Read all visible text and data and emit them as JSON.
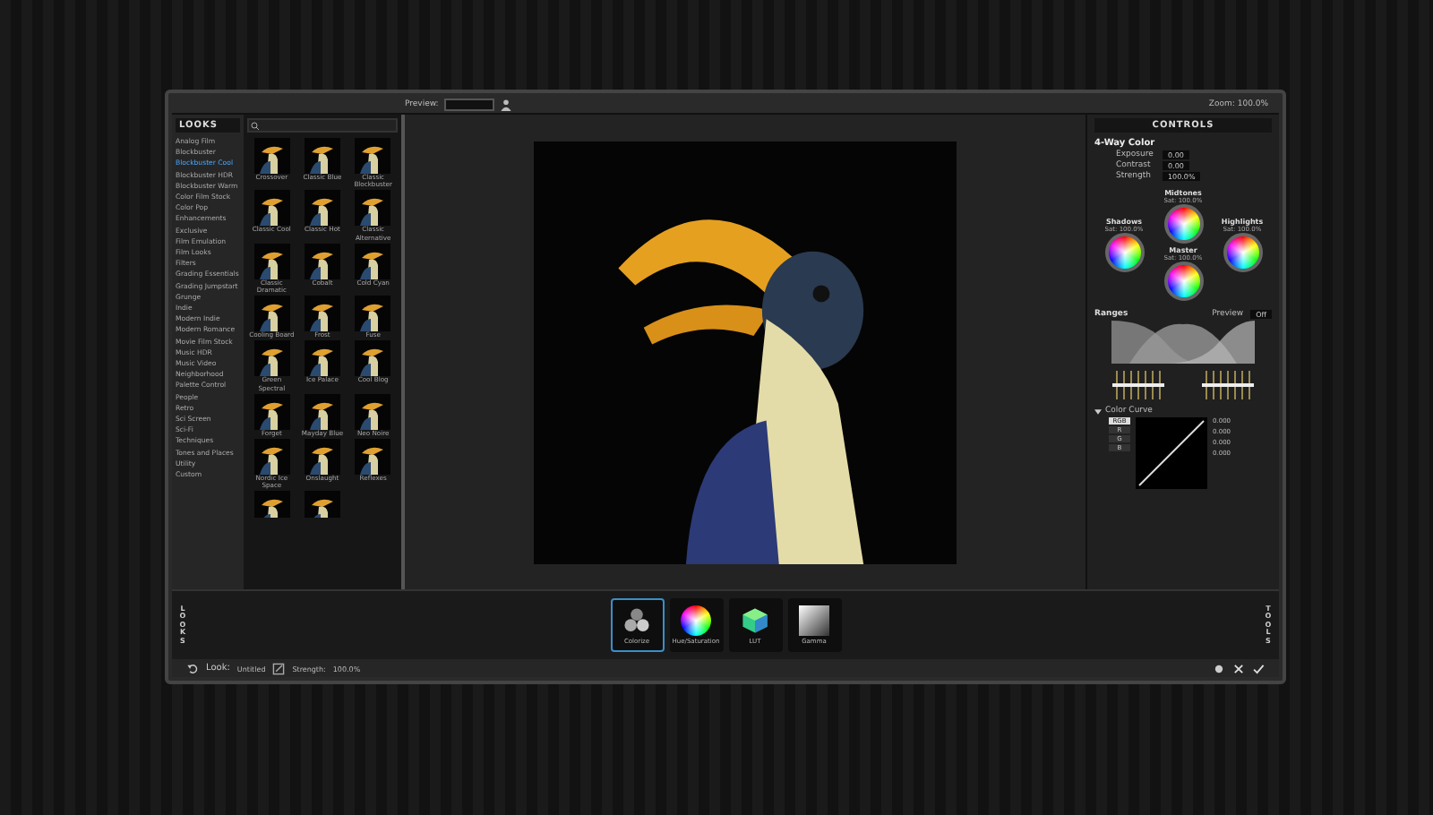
{
  "top_bar": {
    "preview_label": "Preview:",
    "zoom": "Zoom: 100.0%"
  },
  "looks_panel": {
    "title": "LOOKS"
  },
  "categories": [
    {
      "label": "Analog Film",
      "selected": false
    },
    {
      "label": "Blockbuster",
      "selected": false
    },
    {
      "label": "Blockbuster Cool",
      "selected": true
    },
    {
      "label": "Blockbuster HDR",
      "selected": false
    },
    {
      "label": "Blockbuster Warm",
      "selected": false
    },
    {
      "label": "Color Film Stock",
      "selected": false
    },
    {
      "label": "Color Pop",
      "selected": false
    },
    {
      "label": "Enhancements",
      "selected": false
    },
    {
      "label": "Exclusive",
      "selected": false
    },
    {
      "label": "Film Emulation",
      "selected": false
    },
    {
      "label": "Film Looks",
      "selected": false
    },
    {
      "label": "Filters",
      "selected": false
    },
    {
      "label": "Grading Essentials",
      "selected": false
    },
    {
      "label": "Grading Jumpstart",
      "selected": false
    },
    {
      "label": "Grunge",
      "selected": false
    },
    {
      "label": "Indie",
      "selected": false
    },
    {
      "label": "Modern Indie",
      "selected": false
    },
    {
      "label": "Modern Romance",
      "selected": false
    },
    {
      "label": "Movie Film Stock",
      "selected": false
    },
    {
      "label": "Music HDR",
      "selected": false
    },
    {
      "label": "Music Video",
      "selected": false
    },
    {
      "label": "Neighborhood",
      "selected": false
    },
    {
      "label": "Palette Control",
      "selected": false
    },
    {
      "label": "People",
      "selected": false
    },
    {
      "label": "Retro",
      "selected": false
    },
    {
      "label": "Sci Screen",
      "selected": false
    },
    {
      "label": "Sci-Fi",
      "selected": false
    },
    {
      "label": "Techniques",
      "selected": false
    },
    {
      "label": "Tones and Places",
      "selected": false
    },
    {
      "label": "Utility",
      "selected": false
    },
    {
      "label": "Custom",
      "selected": false
    }
  ],
  "thumbnails": [
    {
      "label": "Crossover"
    },
    {
      "label": "Classic Blue"
    },
    {
      "label": "Classic Blockbuster"
    },
    {
      "label": "Classic Cool"
    },
    {
      "label": "Classic Hot"
    },
    {
      "label": "Classic Alternative"
    },
    {
      "label": "Classic Dramatic"
    },
    {
      "label": "Cobalt"
    },
    {
      "label": "Cold Cyan"
    },
    {
      "label": "Cooling Board"
    },
    {
      "label": "Frost"
    },
    {
      "label": "Fuse"
    },
    {
      "label": "Green Spectral"
    },
    {
      "label": "Ice Palace"
    },
    {
      "label": "Cool Blog"
    },
    {
      "label": "Forget"
    },
    {
      "label": "Mayday Blue"
    },
    {
      "label": "Neo Noire"
    },
    {
      "label": "Nordic Ice Space"
    },
    {
      "label": "Onslaught"
    },
    {
      "label": "Reflexes"
    },
    {
      "kind": "cut_off"
    },
    {
      "kind": "cut_off"
    }
  ],
  "controls": {
    "title": "CONTROLS",
    "tool_title": "4-Way Color",
    "params": [
      {
        "name": "Exposure",
        "value": "0.00"
      },
      {
        "name": "Contrast",
        "value": "0.00"
      },
      {
        "name": "Strength",
        "value": "100.0%"
      }
    ],
    "wheels": [
      {
        "name": "Midtones",
        "sat_label": "Sat:",
        "value": "100.0%"
      },
      {
        "name": "Shadows",
        "sat_label": "Sat:",
        "value": "100.0%"
      },
      {
        "name": "Highlights",
        "sat_label": "Sat:",
        "value": "100.0%"
      },
      {
        "name": "Master",
        "sat_label": "Sat:",
        "value": "100.0%"
      }
    ],
    "ranges": {
      "title": "Ranges",
      "preview_label": "Preview",
      "preview_value": "Off"
    },
    "faders": [
      {
        "level": 0.5
      },
      {
        "level": 0.5
      },
      {
        "level": 0.5
      },
      {
        "level": 0.5
      },
      {
        "level": 0.5
      },
      {
        "level": 0.5
      },
      {
        "level": 0.5
      },
      {
        "level": 0.5
      },
      {
        "level": 0.5
      },
      {
        "level": 0.5
      },
      {
        "level": 0.5
      },
      {
        "level": 0.5
      },
      {
        "level": 0.5
      },
      {
        "level": 0.5
      }
    ],
    "curve": {
      "title": "Color Curve",
      "expanded": true,
      "channels": [
        {
          "label": "RGB",
          "selected": true
        },
        {
          "label": "R",
          "selected": false
        },
        {
          "label": "G",
          "selected": false
        },
        {
          "label": "B",
          "selected": false
        }
      ],
      "readouts": [
        "0.000",
        "0.000",
        "0.000",
        "0.000"
      ]
    }
  },
  "side_tabs": {
    "left": "LOOKS",
    "right": "TOOLS"
  },
  "tools": [
    {
      "label": "Colorize",
      "kind": "colorize",
      "selected": true
    },
    {
      "label": "Hue/Saturation",
      "kind": "hue",
      "selected": false
    },
    {
      "label": "LUT",
      "kind": "lut",
      "selected": false
    },
    {
      "label": "Gamma",
      "kind": "gamma",
      "selected": false
    }
  ],
  "status_bar": {
    "look_label": "Look:",
    "look_name": "Untitled",
    "strength_label": "Strength:",
    "strength_value": "100.0%"
  }
}
